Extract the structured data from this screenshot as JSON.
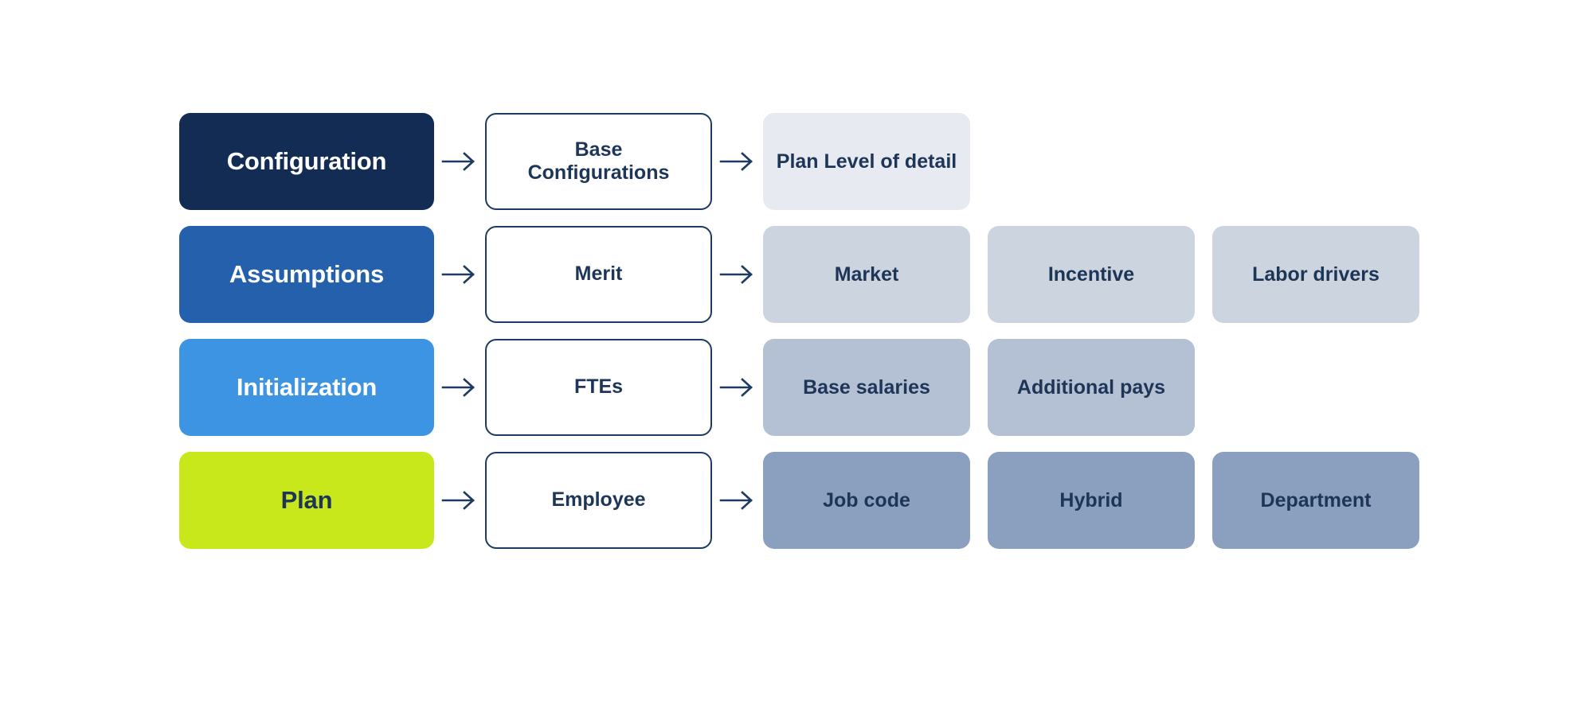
{
  "colors": {
    "background": "#ffffff",
    "text_dark": "#1d3557",
    "outline_border": "#1d3a63",
    "arrow": "#1d3a63",
    "stage_configuration": "#122c54",
    "stage_assumptions": "#2560ad",
    "stage_initialization": "#3d94e3",
    "stage_plan": "#c8e81c",
    "detail_row1": "#e7eaf0",
    "detail_row2": "#ccd4df",
    "detail_row3": "#b4c0d3",
    "detail_row4": "#8ba0bf"
  },
  "icons": {
    "arrow": "arrow-right-icon"
  },
  "rows": [
    {
      "stage": {
        "label": "Configuration",
        "bg": "#122c54",
        "color": "#ffffff"
      },
      "group": {
        "label": "Base\nConfigurations"
      },
      "details": [
        {
          "label": "Plan Level of detail",
          "bg": "#e7eaf0"
        }
      ]
    },
    {
      "stage": {
        "label": "Assumptions",
        "bg": "#2560ad",
        "color": "#ffffff"
      },
      "group": {
        "label": "Merit"
      },
      "details": [
        {
          "label": "Market",
          "bg": "#ccd4df"
        },
        {
          "label": "Incentive",
          "bg": "#ccd4df"
        },
        {
          "label": "Labor drivers",
          "bg": "#ccd4df"
        }
      ]
    },
    {
      "stage": {
        "label": "Initialization",
        "bg": "#3d94e3",
        "color": "#ffffff"
      },
      "group": {
        "label": "FTEs"
      },
      "details": [
        {
          "label": "Base salaries",
          "bg": "#b4c0d3"
        },
        {
          "label": "Additional pays",
          "bg": "#b4c0d3"
        }
      ]
    },
    {
      "stage": {
        "label": "Plan",
        "bg": "#c8e81c",
        "color": "#1d3557"
      },
      "group": {
        "label": "Employee"
      },
      "details": [
        {
          "label": "Job code",
          "bg": "#8ba0bf"
        },
        {
          "label": "Hybrid",
          "bg": "#8ba0bf"
        },
        {
          "label": "Department",
          "bg": "#8ba0bf"
        }
      ]
    }
  ]
}
